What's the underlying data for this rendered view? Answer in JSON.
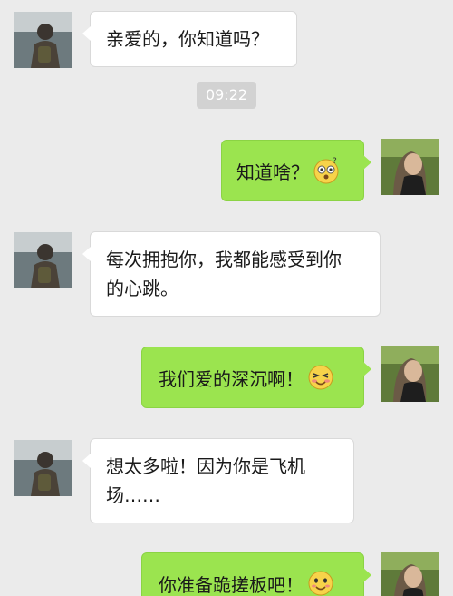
{
  "timestamp": "09:22",
  "messages": [
    {
      "side": "left",
      "text": "亲爱的，你知道吗？"
    },
    {
      "side": "right",
      "text": "知道啥？",
      "emoji": "dizzy-confused-face-icon"
    },
    {
      "side": "left",
      "lines": [
        "每次拥抱你，我都能感受到你",
        "的心跳。"
      ]
    },
    {
      "side": "right",
      "text": "我们爱的深沉啊！",
      "emoji": "smiling-blushing-face-icon"
    },
    {
      "side": "left",
      "lines": [
        "想太多啦！因为你是飞机",
        "场……"
      ]
    },
    {
      "side": "right",
      "text": "你准备跪搓板吧！",
      "emoji": "smiling-face-icon"
    }
  ],
  "colors": {
    "background": "#ebebeb",
    "incoming_bubble": "#ffffff",
    "outgoing_bubble": "#9be44f",
    "timestamp_pill": "#d2d2d2"
  }
}
